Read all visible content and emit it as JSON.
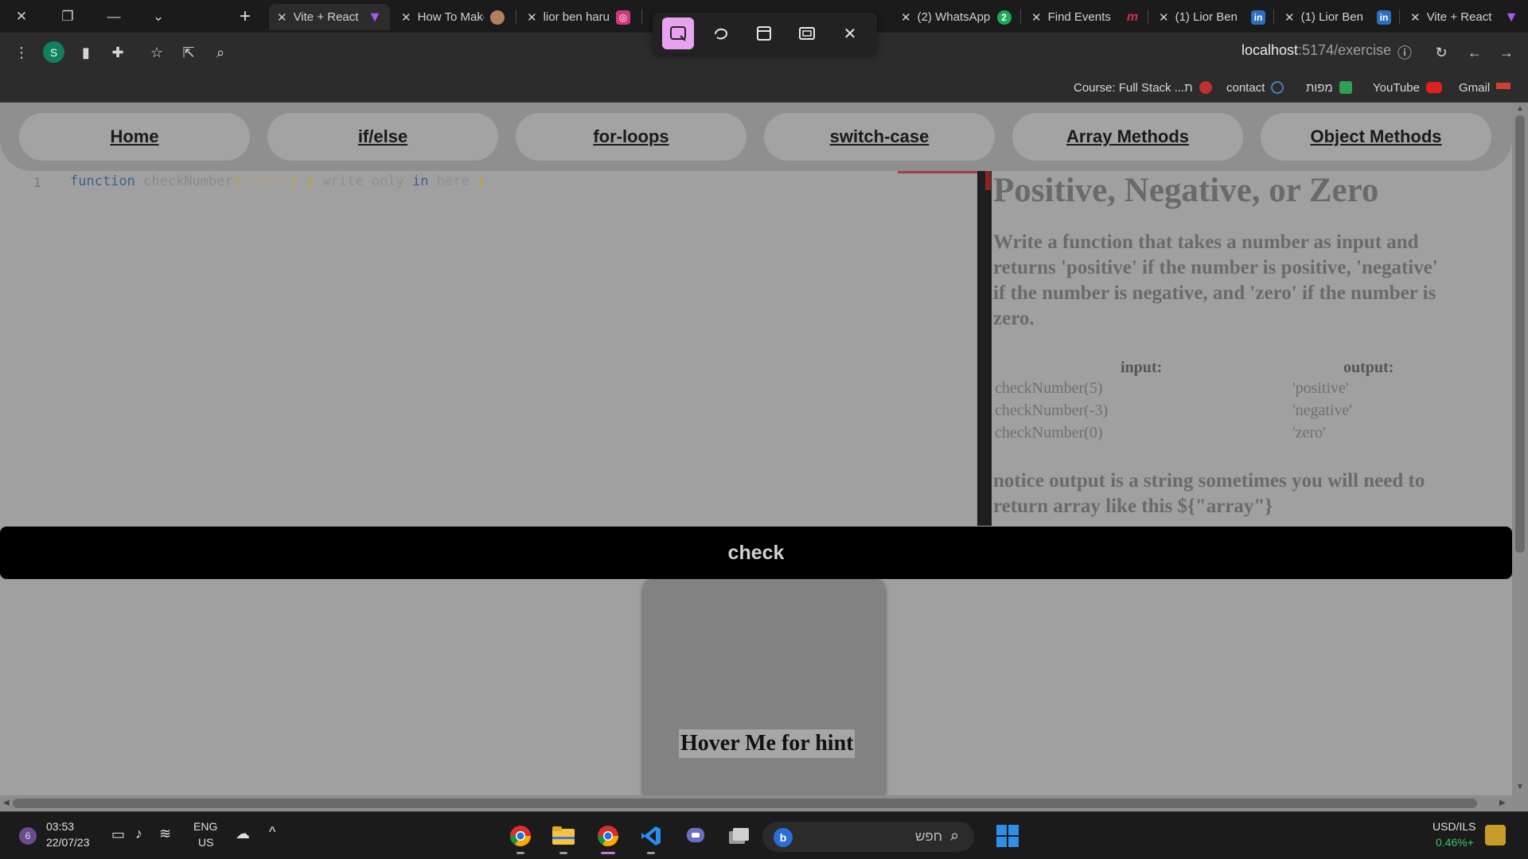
{
  "browser": {
    "tabs": [
      {
        "title": "Vite + React",
        "favicon": "vite-icon",
        "color": "#a45cf0"
      },
      {
        "title": "How To Make",
        "favicon": "cookie-icon",
        "color": "#b08060"
      },
      {
        "title": "lior ben harush",
        "favicon": "instagram-icon",
        "color": "#d0387a"
      },
      {
        "title": "(2) WhatsApp",
        "favicon": "whatsapp-icon",
        "color": "#1fa855"
      },
      {
        "title": "Find Events",
        "favicon": "meetup-icon",
        "color": "#d0304a"
      },
      {
        "title": "(1) Lior Ben",
        "favicon": "linkedin-icon",
        "color": "#2d6fbe"
      },
      {
        "title": "(1) Lior Ben",
        "favicon": "linkedin-icon",
        "color": "#2d6fbe"
      },
      {
        "title": "Vite + React",
        "favicon": "vite-icon",
        "color": "#a45cf0"
      }
    ],
    "whatsapp_badge": "2",
    "profile_initial": "S",
    "url_host": "localhost",
    "url_path": ":5174/exercise",
    "bookmarks": [
      {
        "label": "Course: Full Stack ...ת",
        "color": "#c03030"
      },
      {
        "label": "contact",
        "color": "#4a7fb0"
      },
      {
        "label": "מפות",
        "color": "#2ea055"
      },
      {
        "label": "YouTube",
        "color": "#e02020"
      },
      {
        "label": "Gmail",
        "color": "#d04030"
      }
    ]
  },
  "nav": {
    "items": [
      "Home",
      "if/else",
      "for-loops",
      "switch-case",
      "Array Methods",
      "Object Methods"
    ]
  },
  "editor": {
    "line_number": "1",
    "code": {
      "kw": "function",
      "fn": "checkNumber",
      "open_paren": "(",
      "param": "number",
      "close_paren": ")",
      "open_brace": "{",
      "body_a": "write only",
      "body_kw": "in",
      "body_b": "here",
      "close_brace": "}"
    }
  },
  "exercise": {
    "title": "Positive, Negative, or Zero",
    "description": "Write a function that takes a number as input and returns 'positive' if the number is positive, 'negative' if the number is negative, and 'zero' if the number is zero.",
    "input_header": "input:",
    "output_header": "output:",
    "examples": [
      {
        "input": "checkNumber(5)",
        "output": "'positive'"
      },
      {
        "input": "checkNumber(-3)",
        "output": "'negative'"
      },
      {
        "input": "checkNumber(0)",
        "output": "'zero'"
      }
    ],
    "note": "notice output is a string sometimes you will need to return array like this ${\"array\"}"
  },
  "check_label": "check",
  "hint_label": "Hover Me for hint",
  "taskbar": {
    "notification_count": "6",
    "time": "03:53",
    "date": "22/07/23",
    "lang_top": "ENG",
    "lang_bottom": "US",
    "search_placeholder": "חפש",
    "ticker_name": "USD/ILS",
    "ticker_change": "0.46%+"
  }
}
